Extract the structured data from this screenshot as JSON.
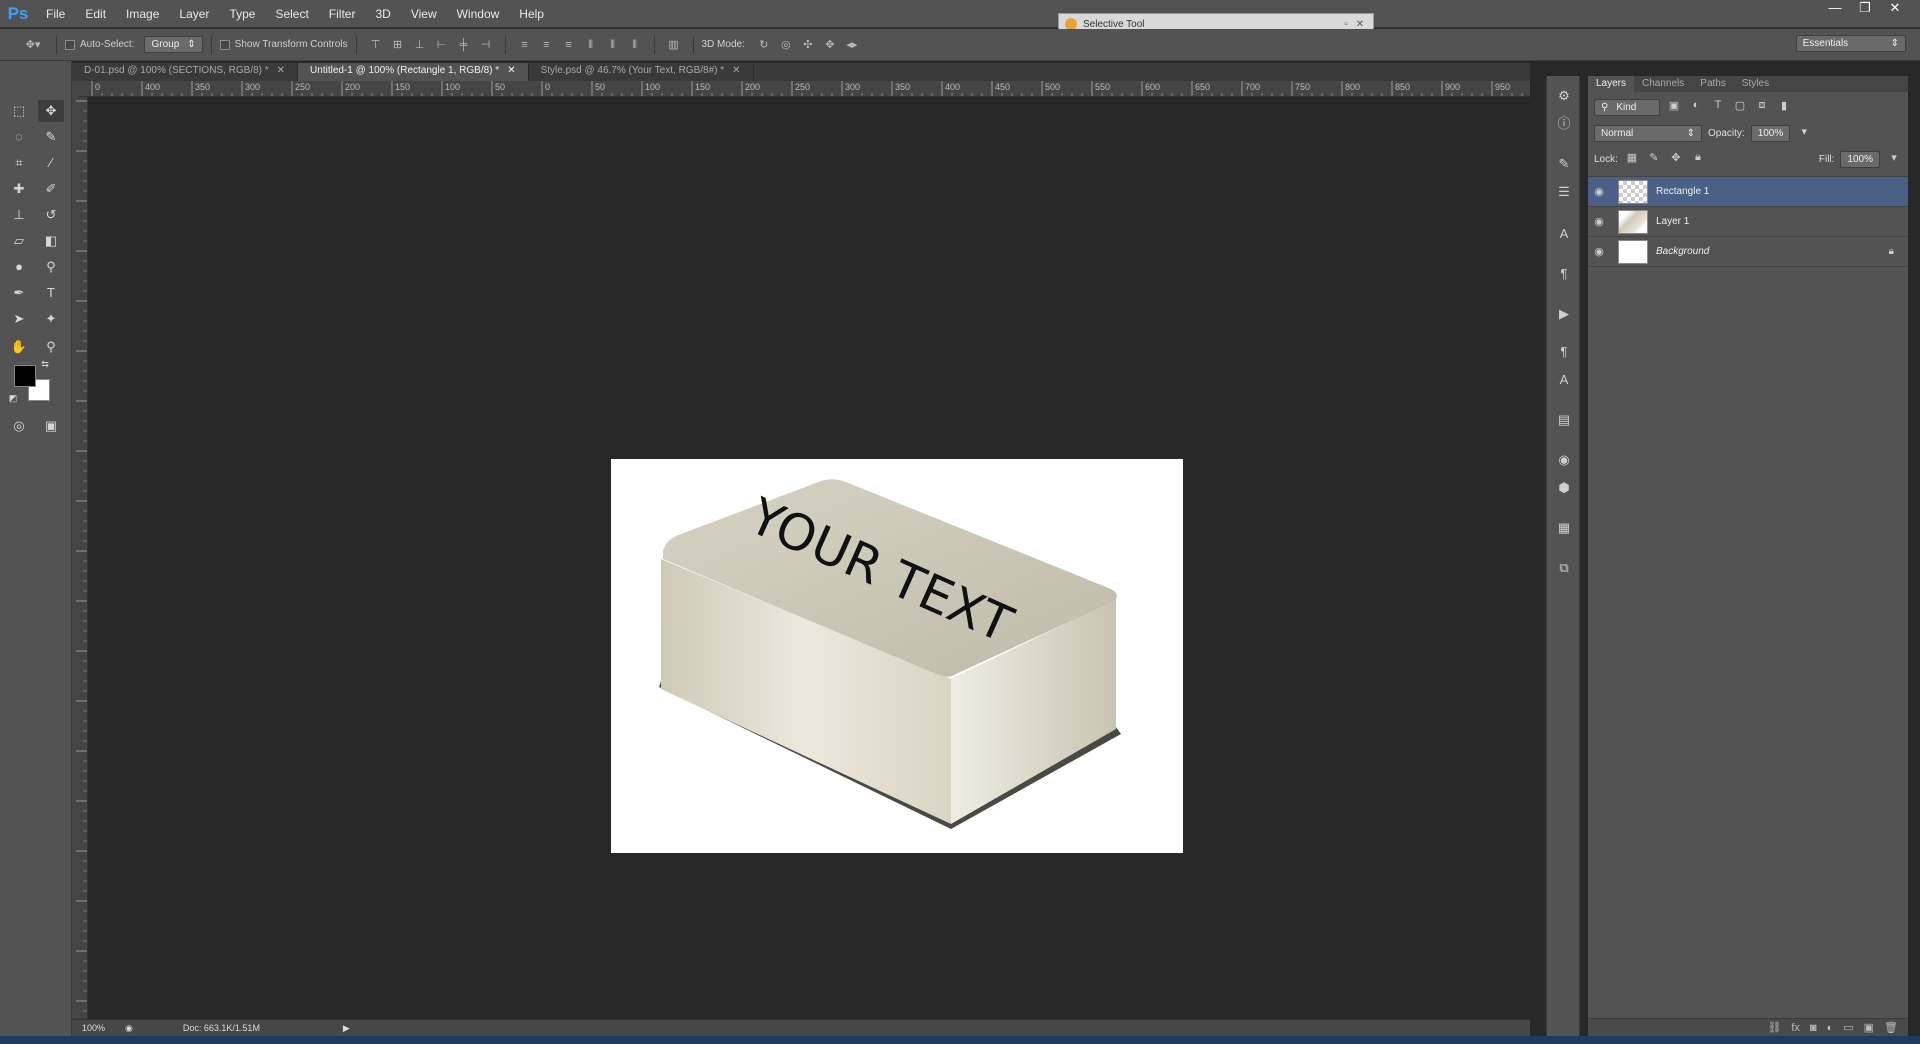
{
  "app": {
    "logo": "Ps",
    "menu": [
      "File",
      "Edit",
      "Image",
      "Layer",
      "Type",
      "Select",
      "Filter",
      "3D",
      "View",
      "Window",
      "Help"
    ],
    "window_controls": [
      "—",
      "❐",
      "✕"
    ]
  },
  "floating_panel": {
    "title": "Selective Tool"
  },
  "options": {
    "auto_select_label": "Auto-Select:",
    "auto_select_value": "Group",
    "show_transform_label": "Show Transform Controls",
    "mode_3d_label": "3D Mode:",
    "workspace": "Essentials"
  },
  "tabs": [
    {
      "label": "D-01.psd @ 100% (SECTIONS, RGB/8) *"
    },
    {
      "label": "Untitled-1 @ 100% (Rectangle 1, RGB/8) *"
    },
    {
      "label": "Style.psd @ 46.7% (Your Text, RGB/8#) *"
    }
  ],
  "ruler_labels": [
    "0",
    "400",
    "350",
    "300",
    "250",
    "200",
    "150",
    "100",
    "50",
    "0",
    "50",
    "100",
    "150",
    "200",
    "250",
    "300",
    "350",
    "400",
    "450",
    "500",
    "550",
    "600",
    "650",
    "700",
    "750",
    "800",
    "850",
    "900",
    "950",
    "1"
  ],
  "document": {
    "overlay_text": "YOUR TEXT"
  },
  "status": {
    "zoom": "100%",
    "doc": "Doc: 663.1K/1.51M"
  },
  "layers_panel": {
    "tabs": [
      "Layers",
      "Channels",
      "Paths",
      "Styles"
    ],
    "filter": "Kind",
    "blend_mode": "Normal",
    "opacity_label": "Opacity:",
    "opacity_value": "100%",
    "lock_label": "Lock:",
    "fill_label": "Fill:",
    "fill_value": "100%",
    "layers": [
      {
        "name": "Rectangle 1",
        "selected": true
      },
      {
        "name": "Layer 1",
        "selected": false
      },
      {
        "name": "Background",
        "selected": false
      }
    ]
  },
  "colors": {
    "accent": "#3ba1ff",
    "selection": "#4a6086",
    "workspace_bg": "#282828",
    "panel_bg": "#535353"
  }
}
